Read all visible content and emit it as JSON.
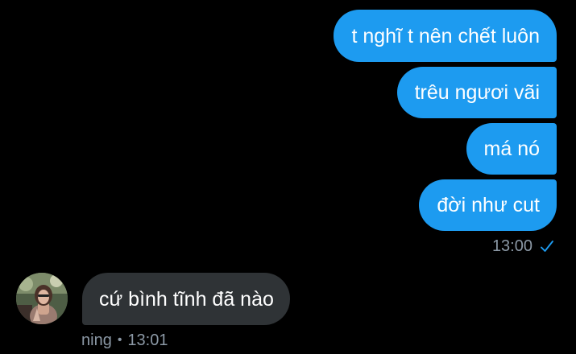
{
  "conversation": {
    "outgoing": [
      "t nghĩ t nên chết luôn",
      "trêu ngươi vãi",
      "má nó",
      "đời như cut"
    ],
    "outgoing_time": "13:00",
    "incoming": [
      "cứ bình tĩnh đã nào"
    ],
    "incoming_sender": "ning",
    "incoming_separator": "•",
    "incoming_time": "13:01"
  },
  "colors": {
    "background": "#000000",
    "outgoing_bubble": "#1d9bf0",
    "incoming_bubble": "#2f3336",
    "meta_text": "#8b98a5",
    "read_check": "#1d9bf0"
  },
  "icons": {
    "status": "check-icon",
    "avatar": "avatar"
  }
}
